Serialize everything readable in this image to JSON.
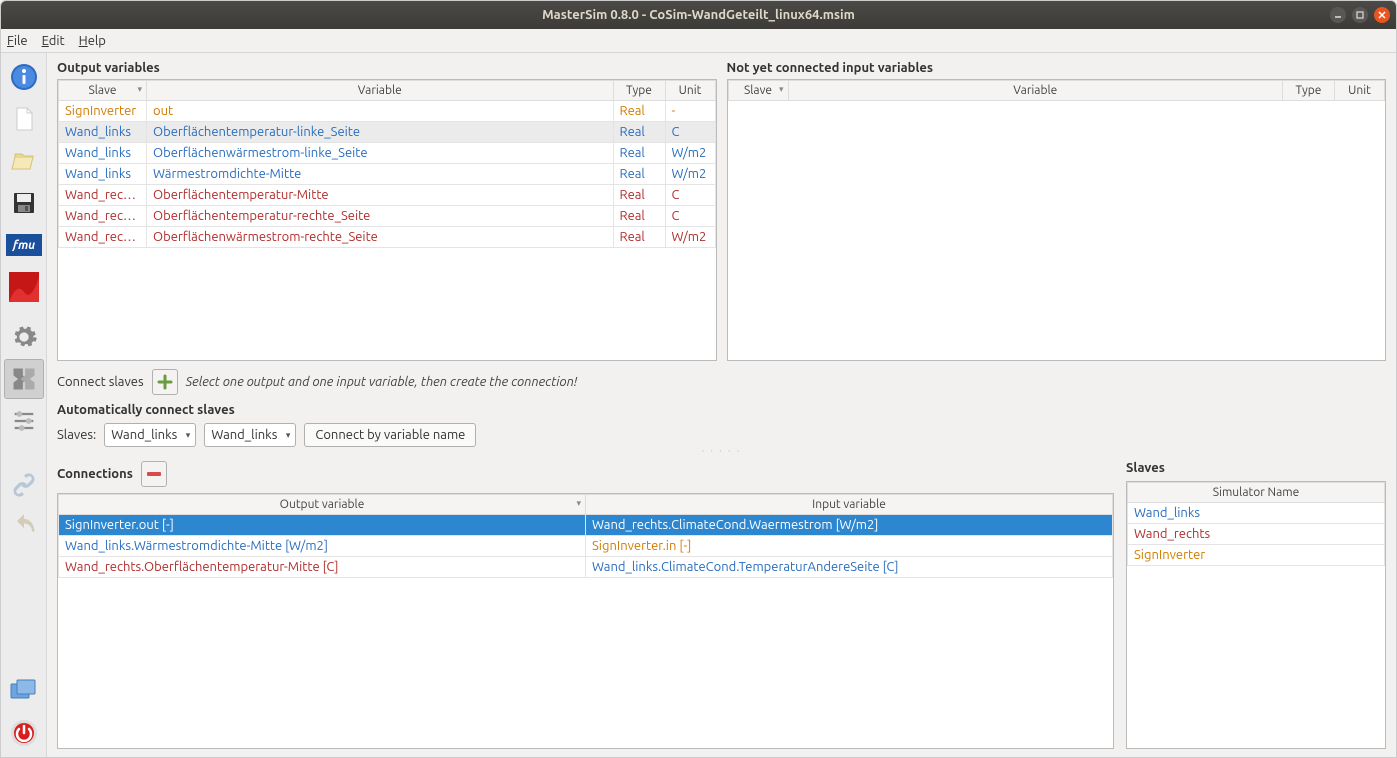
{
  "title": "MasterSim 0.8.0 - CoSim-WandGeteilt_linux64.msim",
  "menu": {
    "file": "File",
    "edit": "Edit",
    "help": "Help"
  },
  "outputVars": {
    "title": "Output variables",
    "headers": {
      "slave": "Slave",
      "variable": "Variable",
      "type": "Type",
      "unit": "Unit"
    },
    "rows": [
      {
        "slave": "SignInverter",
        "variable": "out",
        "type": "Real",
        "unit": "-",
        "color": "orange"
      },
      {
        "slave": "Wand_links",
        "variable": "Oberflächentemperatur-linke_Seite",
        "type": "Real",
        "unit": "C",
        "color": "blue",
        "hl": true
      },
      {
        "slave": "Wand_links",
        "variable": "Oberflächenwärmestrom-linke_Seite",
        "type": "Real",
        "unit": "W/m2",
        "color": "blue"
      },
      {
        "slave": "Wand_links",
        "variable": "Wärmestromdichte-Mitte",
        "type": "Real",
        "unit": "W/m2",
        "color": "blue"
      },
      {
        "slave": "Wand_rechts",
        "variable": "Oberflächentemperatur-Mitte",
        "type": "Real",
        "unit": "C",
        "color": "red"
      },
      {
        "slave": "Wand_rechts",
        "variable": "Oberflächentemperatur-rechte_Seite",
        "type": "Real",
        "unit": "C",
        "color": "red"
      },
      {
        "slave": "Wand_rechts",
        "variable": "Oberflächenwärmestrom-rechte_Seite",
        "type": "Real",
        "unit": "W/m2",
        "color": "red"
      }
    ]
  },
  "inputVars": {
    "title": "Not yet connected input variables",
    "headers": {
      "slave": "Slave",
      "variable": "Variable",
      "type": "Type",
      "unit": "Unit"
    }
  },
  "connectSlaves": {
    "label": "Connect slaves",
    "hint": "Select one output and one input variable, then create the connection!"
  },
  "autoConnect": {
    "title": "Automatically connect slaves",
    "slavesLabel": "Slaves:",
    "combo1": "Wand_links",
    "combo2": "Wand_links",
    "button": "Connect by variable name"
  },
  "connections": {
    "title": "Connections",
    "headers": {
      "out": "Output variable",
      "in": "Input variable"
    },
    "rows": [
      {
        "out": "SignInverter.out [-]",
        "in": "Wand_rechts.ClimateCond.Waermestrom [W/m2]",
        "outColor": "",
        "inColor": "",
        "selected": true
      },
      {
        "out": "Wand_links.Wärmestromdichte-Mitte [W/m2]",
        "in": "SignInverter.in [-]",
        "outColor": "blue",
        "inColor": "orange"
      },
      {
        "out": "Wand_rechts.Oberflächentemperatur-Mitte [C]",
        "in": "Wand_links.ClimateCond.TemperaturAndereSeite [C]",
        "outColor": "red",
        "inColor": "blue"
      }
    ]
  },
  "slavesPanel": {
    "title": "Slaves",
    "header": "Simulator Name",
    "rows": [
      {
        "name": "Wand_links",
        "color": "blue"
      },
      {
        "name": "Wand_rechts",
        "color": "red"
      },
      {
        "name": "SignInverter",
        "color": "orange"
      }
    ]
  }
}
